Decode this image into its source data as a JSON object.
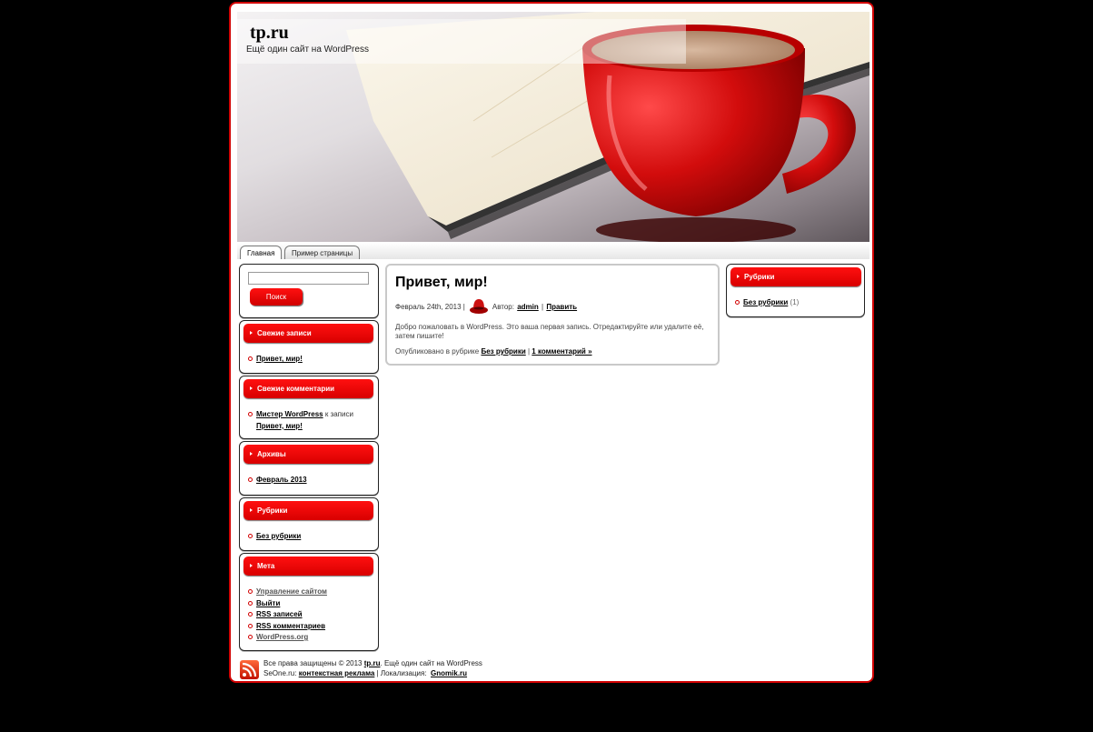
{
  "site": {
    "title": "tp.ru",
    "description": "Ещё один сайт на WordPress"
  },
  "nav": {
    "tabs": [
      {
        "label": "Главная"
      },
      {
        "label": "Пример страницы"
      }
    ]
  },
  "left_sidebar": {
    "search": {
      "placeholder": "",
      "button_label": "Поиск"
    },
    "recent_posts": {
      "title": "Свежие записи",
      "items": [
        "Привет, мир!"
      ]
    },
    "recent_comments": {
      "title": "Свежие комментарии",
      "items": [
        {
          "author": "Мистер WordPress",
          "connector": "к записи",
          "post": "Привет, мир!"
        }
      ]
    },
    "archives": {
      "title": "Архивы",
      "items": [
        "Февраль 2013"
      ]
    },
    "categories": {
      "title": "Рубрики",
      "items": [
        "Без рубрики"
      ]
    },
    "meta": {
      "title": "Мета",
      "items": [
        "Управление сайтом",
        "Выйти",
        "RSS записей",
        "RSS комментариев",
        "WordPress.org"
      ]
    }
  },
  "post": {
    "title": "Привет, мир!",
    "date": "Февраль 24th, 2013 |",
    "author_prefix": "Автор:",
    "author": "admin",
    "separator": "|",
    "edit_label": "Править",
    "body": "Добро пожаловать в WordPress. Это ваша первая запись. Отредактируйте или удалите её, затем пишите!",
    "posted_in": "Опубликовано в рубрике",
    "category": "Без рубрики",
    "comments_separator": "|",
    "comments_link": "1 комментарий »"
  },
  "right_sidebar": {
    "categories": {
      "title": "Рубрики",
      "item": "Без рубрики",
      "count": "(1)"
    }
  },
  "footer": {
    "rights": "Все права защищены © 2013",
    "site_link": "tp.ru",
    "rights_suffix": ". Ещё один сайт на WordPress",
    "seo_prefix": "SeOne.ru:",
    "ads_link": "контекстная реклама",
    "loc_prefix": "| Локализация:",
    "loc_link": "Gnomik.ru"
  },
  "colors": {
    "accent": "#d10000",
    "background": "#000000",
    "page": "#ffffff"
  }
}
